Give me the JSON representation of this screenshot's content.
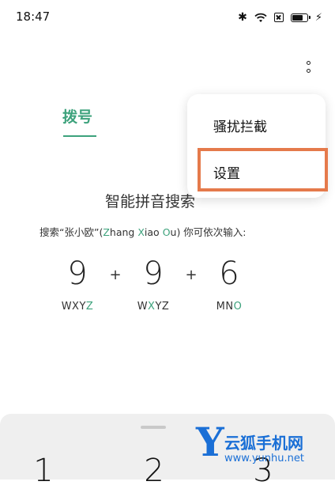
{
  "status_bar": {
    "time": "18:47"
  },
  "tabs": {
    "dial": "拨号"
  },
  "menu": {
    "items": [
      "骚扰拦截",
      "设置"
    ]
  },
  "intro": {
    "title": "智能拼音搜索",
    "subtitle_parts": [
      "搜索“张小欧”(",
      "Z",
      "hang ",
      "X",
      "iao ",
      "O",
      "u) 你可依次输入:"
    ],
    "digits": [
      "9",
      "9",
      "6"
    ],
    "plus": "+",
    "letter_groups": [
      {
        "normal": "WXY",
        "highlight": "Z",
        "after": ""
      },
      {
        "normal": "W",
        "highlight": "X",
        "after": "YZ"
      },
      {
        "normal": "MN",
        "highlight": "O",
        "after": ""
      }
    ]
  },
  "keypad": {
    "visible_keys": [
      "1",
      "2",
      "3"
    ]
  },
  "watermark": {
    "letter": "Y",
    "name": "云狐手机网",
    "url": "www.yunhu.net"
  },
  "colors": {
    "accent": "#3da27c",
    "highlight_box": "#e57a4b",
    "watermark": "#1a6fd6"
  }
}
